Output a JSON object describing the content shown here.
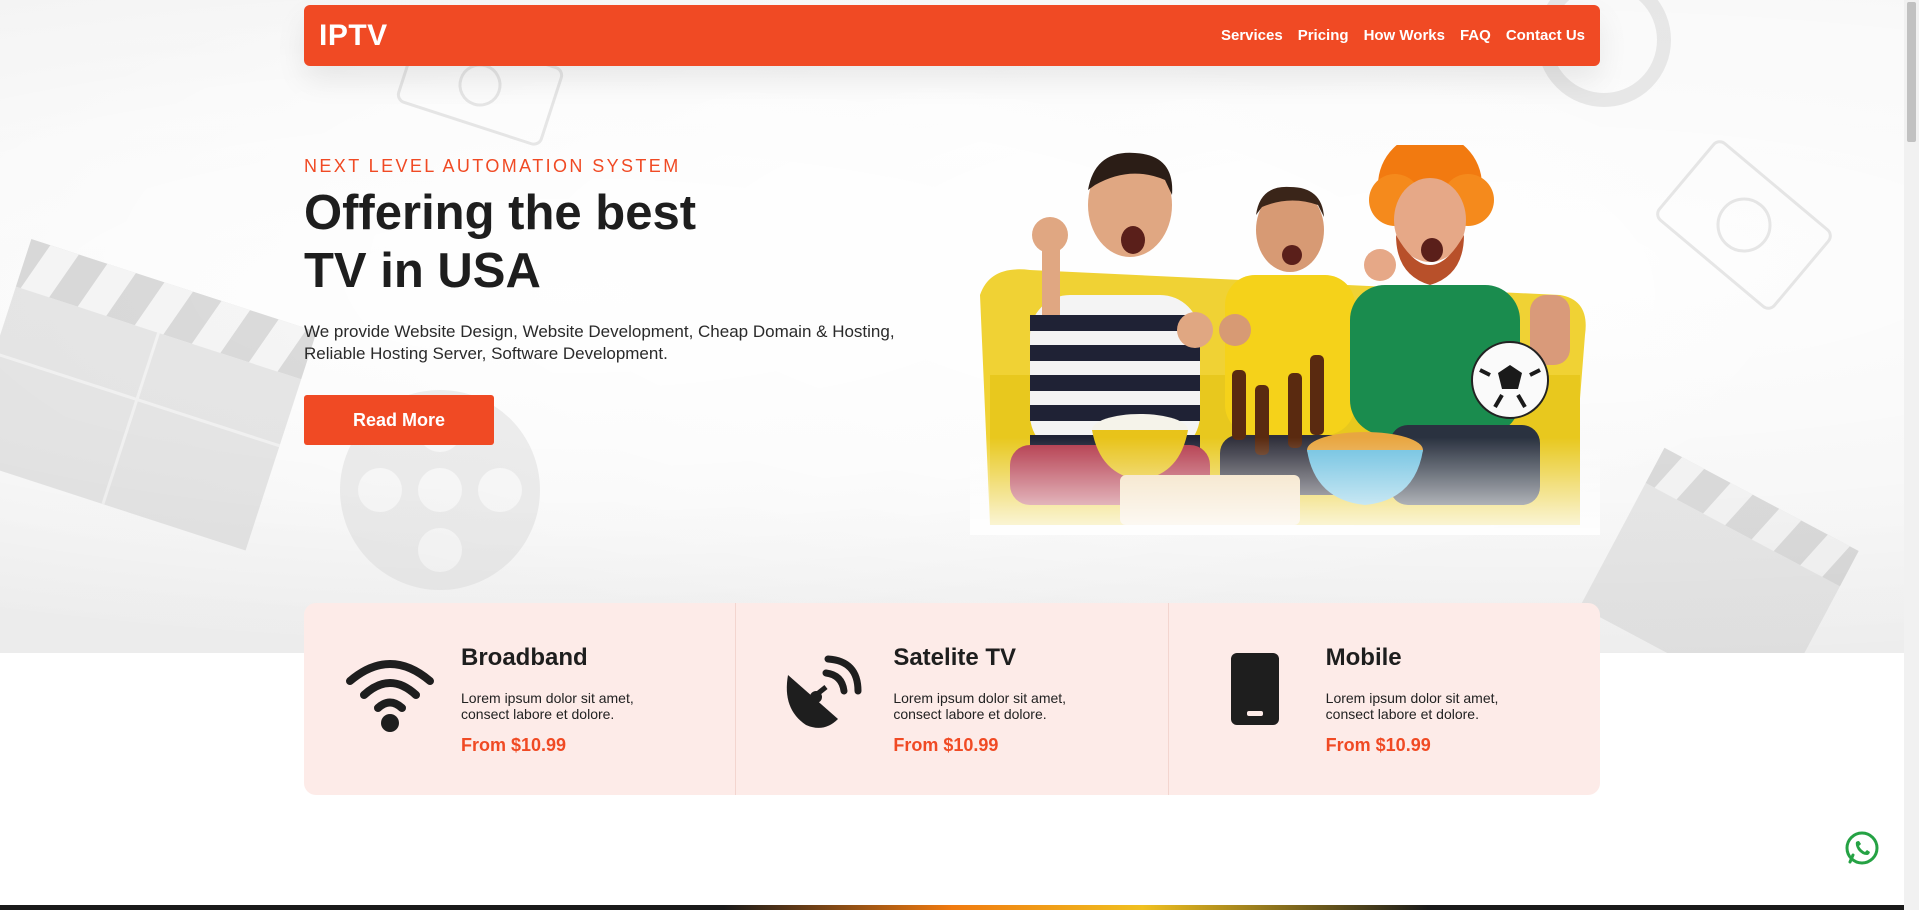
{
  "header": {
    "brand": "IPTV",
    "nav": [
      "Services",
      "Pricing",
      "How Works",
      "FAQ",
      "Contact Us"
    ]
  },
  "hero": {
    "eyebrow": "NEXT LEVEL AUTOMATION SYSTEM",
    "title_line1": "Offering the best",
    "title_line2": "TV in USA",
    "description": "We provide Website Design, Website Development, Cheap Domain & Hosting, Reliable Hosting Server, Software Development.",
    "cta_label": "Read More"
  },
  "services": [
    {
      "title": "Broadband",
      "icon": "wifi-icon",
      "description": "Lorem ipsum dolor sit amet, consect labore et dolore.",
      "price": "From $10.99"
    },
    {
      "title": "Satelite TV",
      "icon": "satellite-dish-icon",
      "description": "Lorem ipsum dolor sit amet, consect labore et dolore.",
      "price": "From $10.99"
    },
    {
      "title": "Mobile",
      "icon": "mobile-phone-icon",
      "description": "Lorem ipsum dolor sit amet, consect labore et dolore.",
      "price": "From $10.99"
    }
  ],
  "colors": {
    "accent": "#f04a24",
    "service_bg": "#fdebe8",
    "text_dark": "#1e1e1e",
    "whatsapp": "#25a244"
  }
}
